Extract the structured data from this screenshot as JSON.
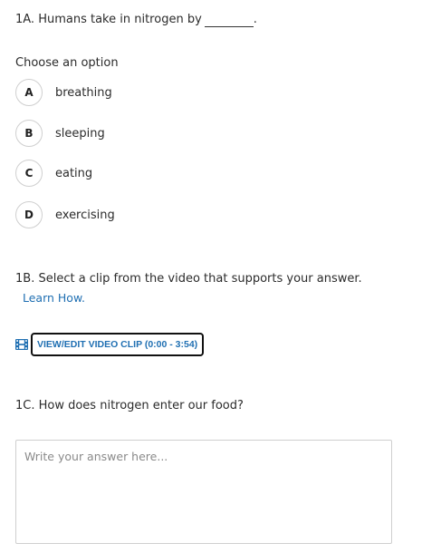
{
  "q1a": {
    "text": "1A. Humans take in nitrogen by",
    "suffix": "."
  },
  "choose_label": "Choose an option",
  "options": [
    {
      "letter": "A",
      "label": "breathing"
    },
    {
      "letter": "B",
      "label": "sleeping"
    },
    {
      "letter": "C",
      "label": "eating"
    },
    {
      "letter": "D",
      "label": "exercising"
    }
  ],
  "q1b": {
    "text": "1B. Select a clip from the video that supports your answer.",
    "learn_link": "Learn How."
  },
  "clip": {
    "button_label": "VIEW/EDIT VIDEO CLIP (0:00 - 3:54)",
    "icon": "film-icon",
    "accent": "#1f6fb2"
  },
  "q1c": {
    "text": "1C. How does nitrogen enter our food?"
  },
  "answer": {
    "placeholder": "Write your answer here...",
    "value": ""
  }
}
